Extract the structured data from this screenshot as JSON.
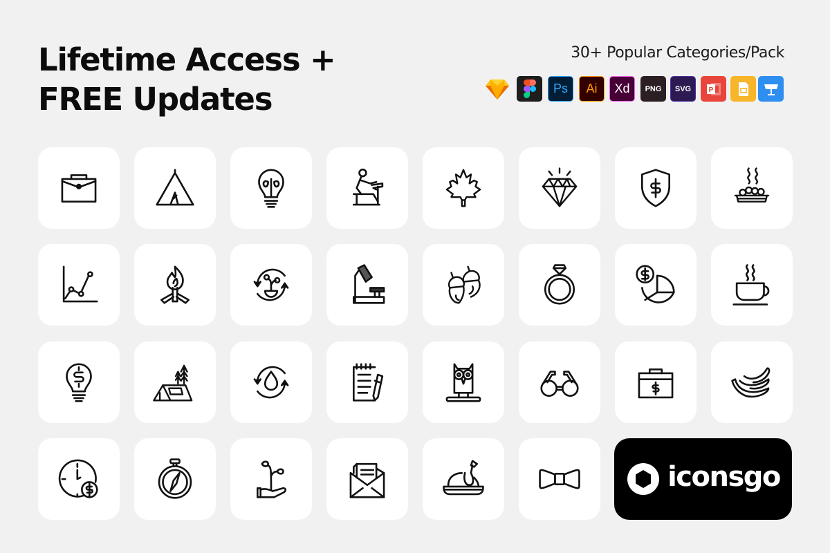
{
  "headline": {
    "line1": "Lifetime Access +",
    "line2": "FREE Updates"
  },
  "subtitle": "30+ Popular Categories/Pack",
  "formats": [
    {
      "name": "Sketch",
      "icon": "sketch-diamond-icon",
      "label": "",
      "bg": "#fdb300",
      "fg": "#ffffff"
    },
    {
      "name": "Figma",
      "icon": "figma-icon",
      "label": "",
      "bg": "#1e1e1e",
      "fg": "#ffffff"
    },
    {
      "name": "Photoshop",
      "icon": "photoshop-icon",
      "label": "Ps",
      "bg": "#001e36",
      "fg": "#31a8ff"
    },
    {
      "name": "Illustrator",
      "icon": "illustrator-icon",
      "label": "Ai",
      "bg": "#330000",
      "fg": "#ff9a00"
    },
    {
      "name": "Adobe XD",
      "icon": "xd-icon",
      "label": "Xd",
      "bg": "#470137",
      "fg": "#ffffff"
    },
    {
      "name": "PNG",
      "icon": "png-icon",
      "label": "PNG",
      "bg": "#2b1f23",
      "fg": "#ffffff"
    },
    {
      "name": "SVG",
      "icon": "svg-icon",
      "label": "SVG",
      "bg": "#2d1a52",
      "fg": "#ffffff"
    },
    {
      "name": "PowerPoint",
      "icon": "powerpoint-icon",
      "label": "P",
      "bg": "#e8453c",
      "fg": "#ffffff"
    },
    {
      "name": "Google Slides",
      "icon": "google-slides-icon",
      "label": "",
      "bg": "#f7b529",
      "fg": "#ffffff"
    },
    {
      "name": "Keynote",
      "icon": "keynote-icon",
      "label": "",
      "bg": "#2f8ff0",
      "fg": "#ffffff"
    }
  ],
  "icons": [
    {
      "name": "briefcase-icon"
    },
    {
      "name": "tent-icon"
    },
    {
      "name": "idea-bulb-icon"
    },
    {
      "name": "student-desk-icon"
    },
    {
      "name": "maple-leaf-icon"
    },
    {
      "name": "diamond-icon"
    },
    {
      "name": "shield-dollar-icon"
    },
    {
      "name": "hot-dish-icon"
    },
    {
      "name": "line-chart-icon"
    },
    {
      "name": "campfire-icon"
    },
    {
      "name": "plant-cycle-icon"
    },
    {
      "name": "microscope-lamp-icon"
    },
    {
      "name": "acorns-icon"
    },
    {
      "name": "ring-icon"
    },
    {
      "name": "dollar-pie-chart-icon"
    },
    {
      "name": "coffee-cup-icon"
    },
    {
      "name": "money-bulb-icon"
    },
    {
      "name": "camping-tent-trees-icon"
    },
    {
      "name": "water-cycle-icon"
    },
    {
      "name": "notepad-pencil-icon"
    },
    {
      "name": "owl-icon"
    },
    {
      "name": "glasses-icon"
    },
    {
      "name": "money-box-icon"
    },
    {
      "name": "bananas-icon"
    },
    {
      "name": "time-money-icon"
    },
    {
      "name": "compass-icon"
    },
    {
      "name": "plant-hand-icon"
    },
    {
      "name": "open-envelope-icon"
    },
    {
      "name": "roast-turkey-icon"
    },
    {
      "name": "bow-tie-icon"
    }
  ],
  "brand": {
    "name": "iconsgo",
    "logo_icon": "hexagon-ring-icon"
  }
}
